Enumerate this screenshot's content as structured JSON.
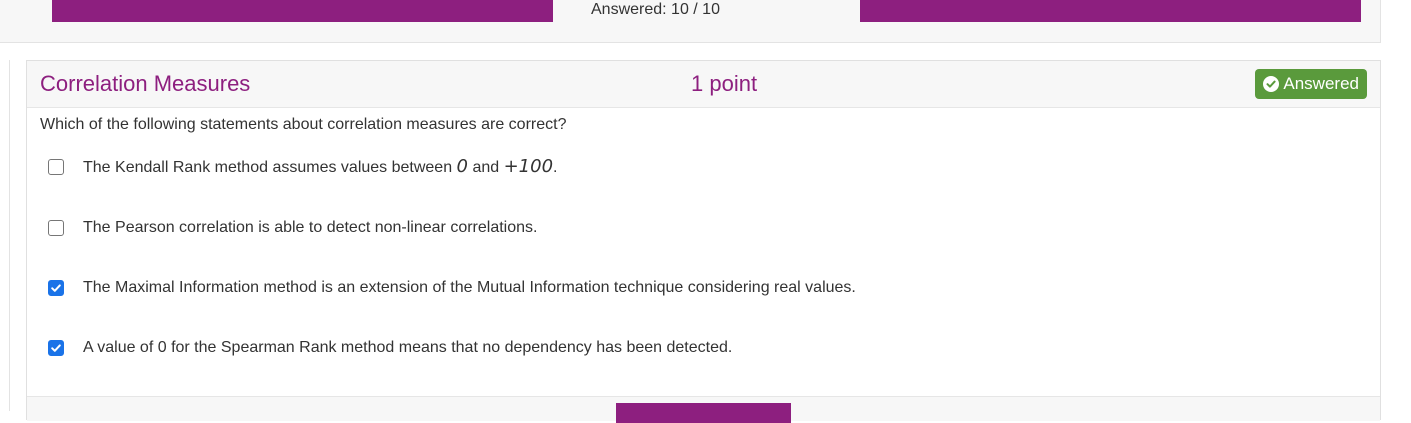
{
  "colors": {
    "brand": "#8d1f7f",
    "success": "#5a9a3c",
    "check": "#1a73e8"
  },
  "progress": {
    "answered_text": "Answered: 10 / 10",
    "answered": 10,
    "total": 10
  },
  "question": {
    "title": "Correlation Measures",
    "points": "1 point",
    "status_icon": "check-circle-icon",
    "status": "Answered",
    "prompt": "Which of the following statements about correlation measures are correct?",
    "options": [
      {
        "checked": false,
        "text_before": "The Kendall Rank method assumes values between ",
        "math1": "0",
        "text_mid": " and ",
        "math2": "+100",
        "text_after": "."
      },
      {
        "checked": false,
        "text": "The Pearson correlation is able to detect non-linear correlations."
      },
      {
        "checked": true,
        "text": "The Maximal Information method is an extension of the Mutual Information technique considering real values."
      },
      {
        "checked": true,
        "text": "A value of 0 for the Spearman Rank method means that no dependency has been detected."
      }
    ]
  }
}
